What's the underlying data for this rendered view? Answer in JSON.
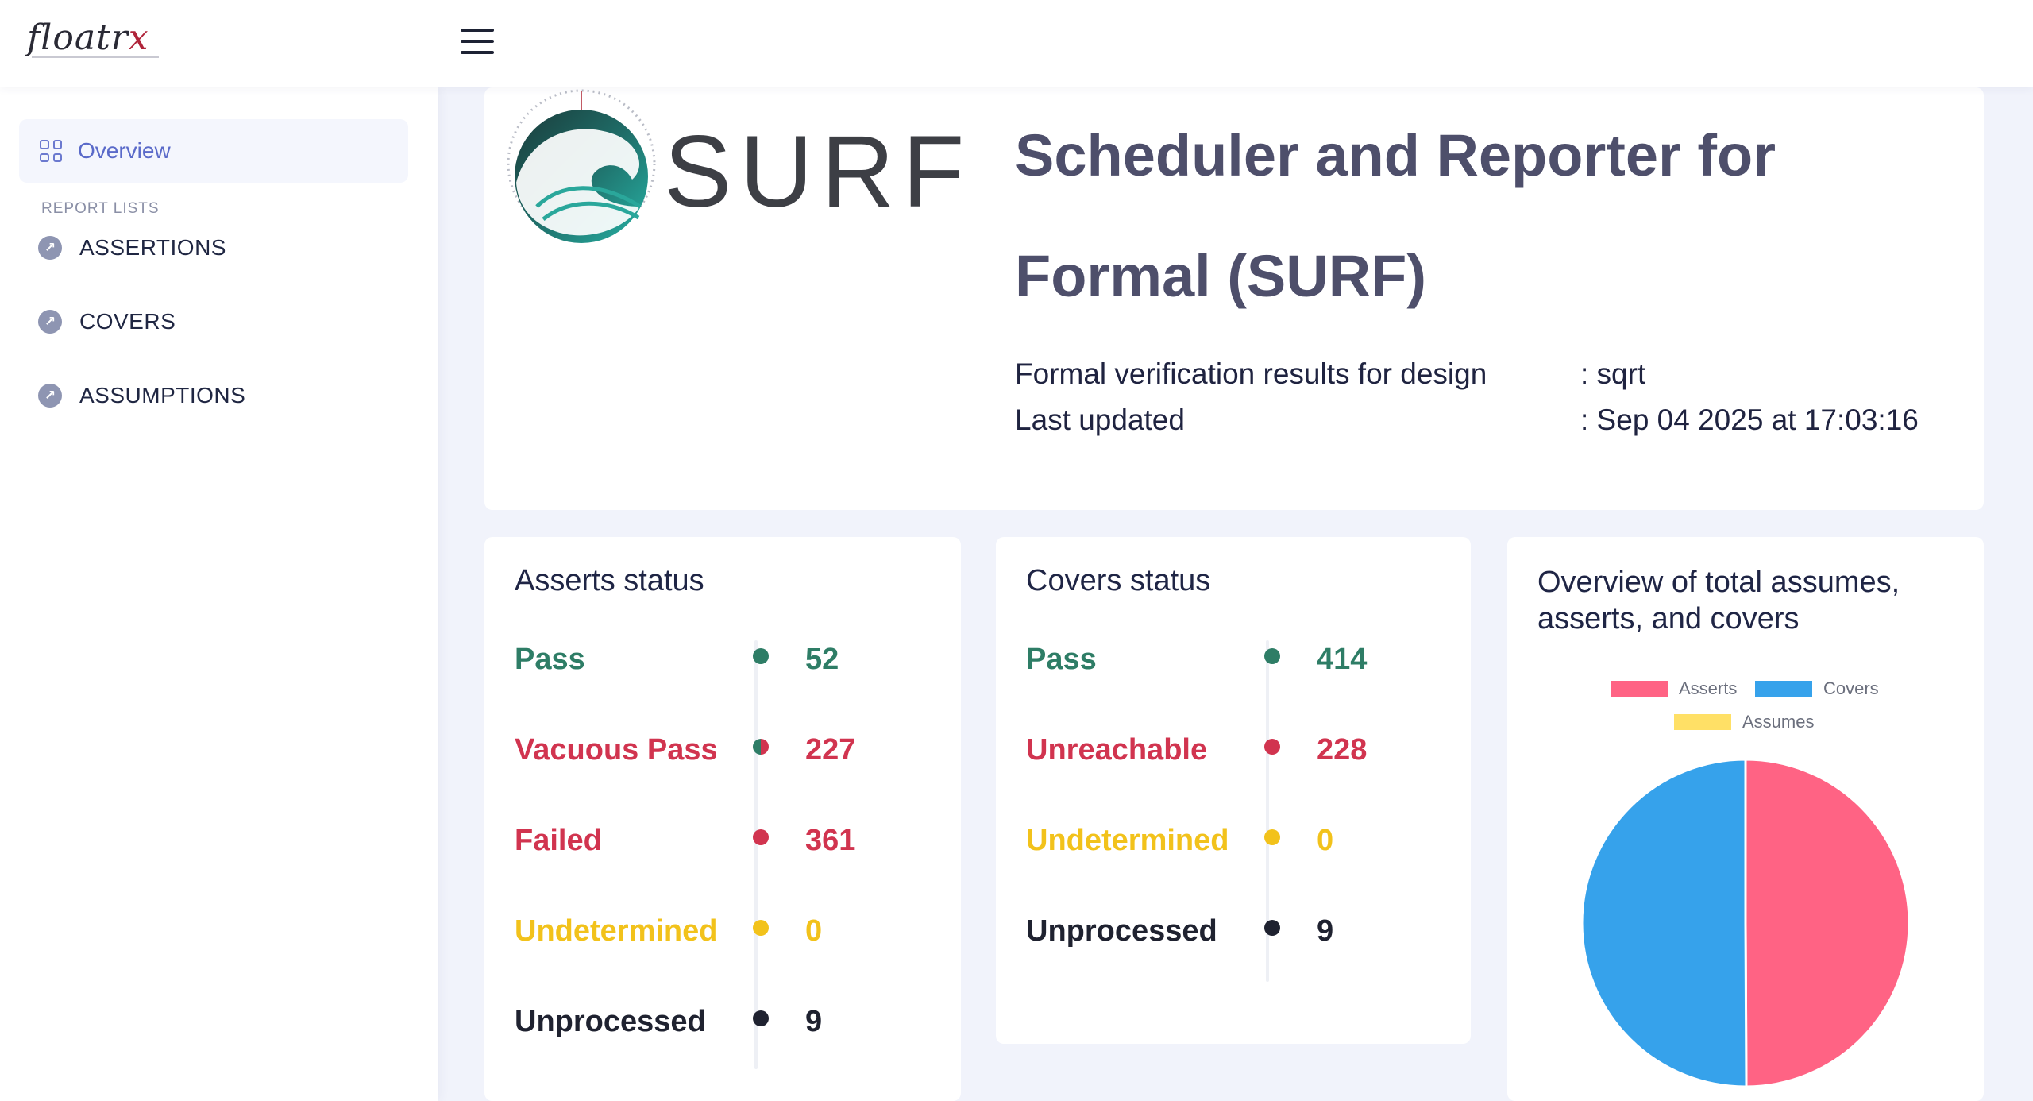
{
  "brand": {
    "name_part1": "floatr",
    "name_part2": "x"
  },
  "sidebar": {
    "overview_label": "Overview",
    "section_label": "REPORT LISTS",
    "items": [
      {
        "label": "ASSERTIONS"
      },
      {
        "label": "COVERS"
      },
      {
        "label": "ASSUMPTIONS"
      }
    ]
  },
  "header": {
    "logo_text": "SURF",
    "title": "Scheduler and Reporter for Formal (SURF)",
    "design_label": "Formal verification results for design",
    "design_value": ": sqrt",
    "updated_label": "Last updated",
    "updated_value": ": Sep 04 2025 at 17:03:16"
  },
  "colors": {
    "pass": "#2e7d66",
    "vacuous": "#d1344f",
    "failed": "#d1344f",
    "unreachable": "#d1344f",
    "undetermined": "#f2c21b",
    "unprocessed": "#1f2230",
    "asserts": "#ff6384",
    "covers": "#36a2eb",
    "assumes": "#ffe066"
  },
  "asserts_card": {
    "title": "Asserts status",
    "stats": [
      {
        "label": "Pass",
        "value": "52"
      },
      {
        "label": "Vacuous Pass",
        "value": "227"
      },
      {
        "label": "Failed",
        "value": "361"
      },
      {
        "label": "Undetermined",
        "value": "0"
      },
      {
        "label": "Unprocessed",
        "value": "9"
      }
    ]
  },
  "covers_card": {
    "title": "Covers status",
    "stats": [
      {
        "label": "Pass",
        "value": "414"
      },
      {
        "label": "Unreachable",
        "value": "228"
      },
      {
        "label": "Undetermined",
        "value": "0"
      },
      {
        "label": "Unprocessed",
        "value": "9"
      }
    ]
  },
  "overview_card": {
    "title": "Overview of total assumes, asserts, and covers"
  },
  "chart_data": {
    "type": "pie",
    "title": "",
    "categories": [
      "Asserts",
      "Covers",
      "Assumes"
    ],
    "values": [
      649,
      651,
      0
    ],
    "legend_position": "top"
  }
}
